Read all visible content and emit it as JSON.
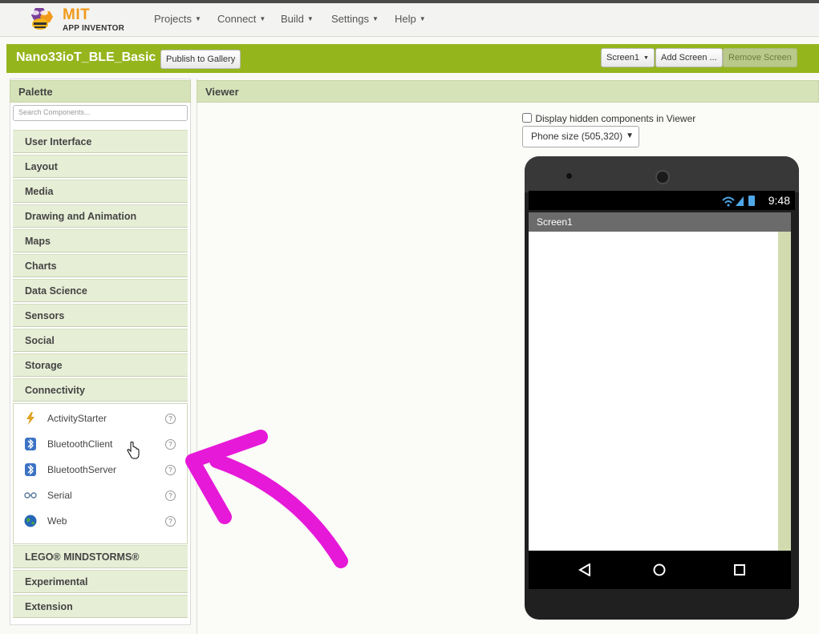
{
  "app": {
    "logo_mit": "MIT",
    "logo_sub": "APP INVENTOR"
  },
  "nav": {
    "projects": "Projects",
    "connect": "Connect",
    "build": "Build",
    "settings": "Settings",
    "help": "Help"
  },
  "project": {
    "name": "Nano33ioT_BLE_Basic",
    "publish_label": "Publish to Gallery",
    "screen_select": "Screen1",
    "add_screen": "Add Screen ...",
    "remove_screen": "Remove Screen"
  },
  "palette": {
    "title": "Palette",
    "search_placeholder": "Search Components...",
    "categories": [
      "User Interface",
      "Layout",
      "Media",
      "Drawing and Animation",
      "Maps",
      "Charts",
      "Data Science",
      "Sensors",
      "Social",
      "Storage",
      "Connectivity",
      "LEGO® MINDSTORMS®",
      "Experimental",
      "Extension"
    ],
    "connectivity_items": [
      "ActivityStarter",
      "BluetoothClient",
      "BluetoothServer",
      "Serial",
      "Web"
    ],
    "help_glyph": "?"
  },
  "viewer": {
    "title": "Viewer",
    "hidden_label": "Display hidden components in Viewer",
    "phone_size": "Phone size (505,320)",
    "clock": "9:48",
    "screen_title": "Screen1"
  },
  "colors": {
    "brand_green": "#95b51d",
    "annotation_arrow": "#e619d8"
  }
}
